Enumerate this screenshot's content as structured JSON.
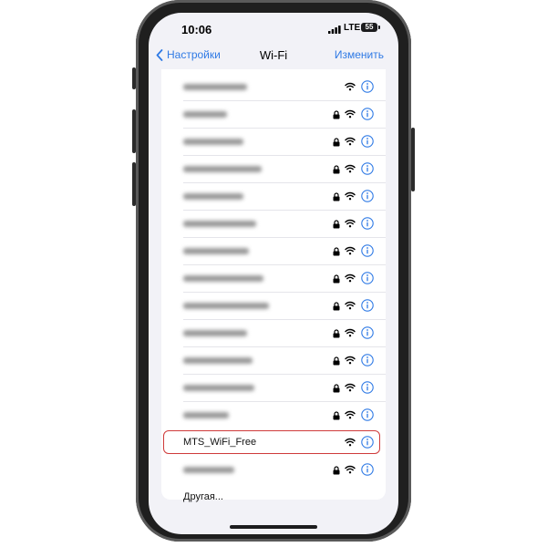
{
  "status_bar": {
    "time": "10:06",
    "network": "LTE",
    "battery": "55"
  },
  "nav": {
    "back_label": "Настройки",
    "title": "Wi-Fi",
    "edit_label": "Изменить"
  },
  "networks": [
    {
      "name": "",
      "secured": false,
      "selected": false
    },
    {
      "name": "",
      "secured": true,
      "selected": false
    },
    {
      "name": "",
      "secured": true,
      "selected": false
    },
    {
      "name": "",
      "secured": true,
      "selected": false
    },
    {
      "name": "",
      "secured": true,
      "selected": false
    },
    {
      "name": "",
      "secured": true,
      "selected": false
    },
    {
      "name": "",
      "secured": true,
      "selected": false
    },
    {
      "name": "",
      "secured": true,
      "selected": false
    },
    {
      "name": "",
      "secured": true,
      "selected": false
    },
    {
      "name": "",
      "secured": true,
      "selected": false
    },
    {
      "name": "",
      "secured": true,
      "selected": false
    },
    {
      "name": "",
      "secured": true,
      "selected": false
    },
    {
      "name": "",
      "secured": true,
      "selected": false
    },
    {
      "name": "MTS_WiFi_Free",
      "secured": false,
      "selected": true
    },
    {
      "name": "",
      "secured": true,
      "selected": false
    }
  ],
  "other_label": "Другая...",
  "colors": {
    "accent": "#2f7ae5",
    "highlight": "#cf3a3a"
  }
}
